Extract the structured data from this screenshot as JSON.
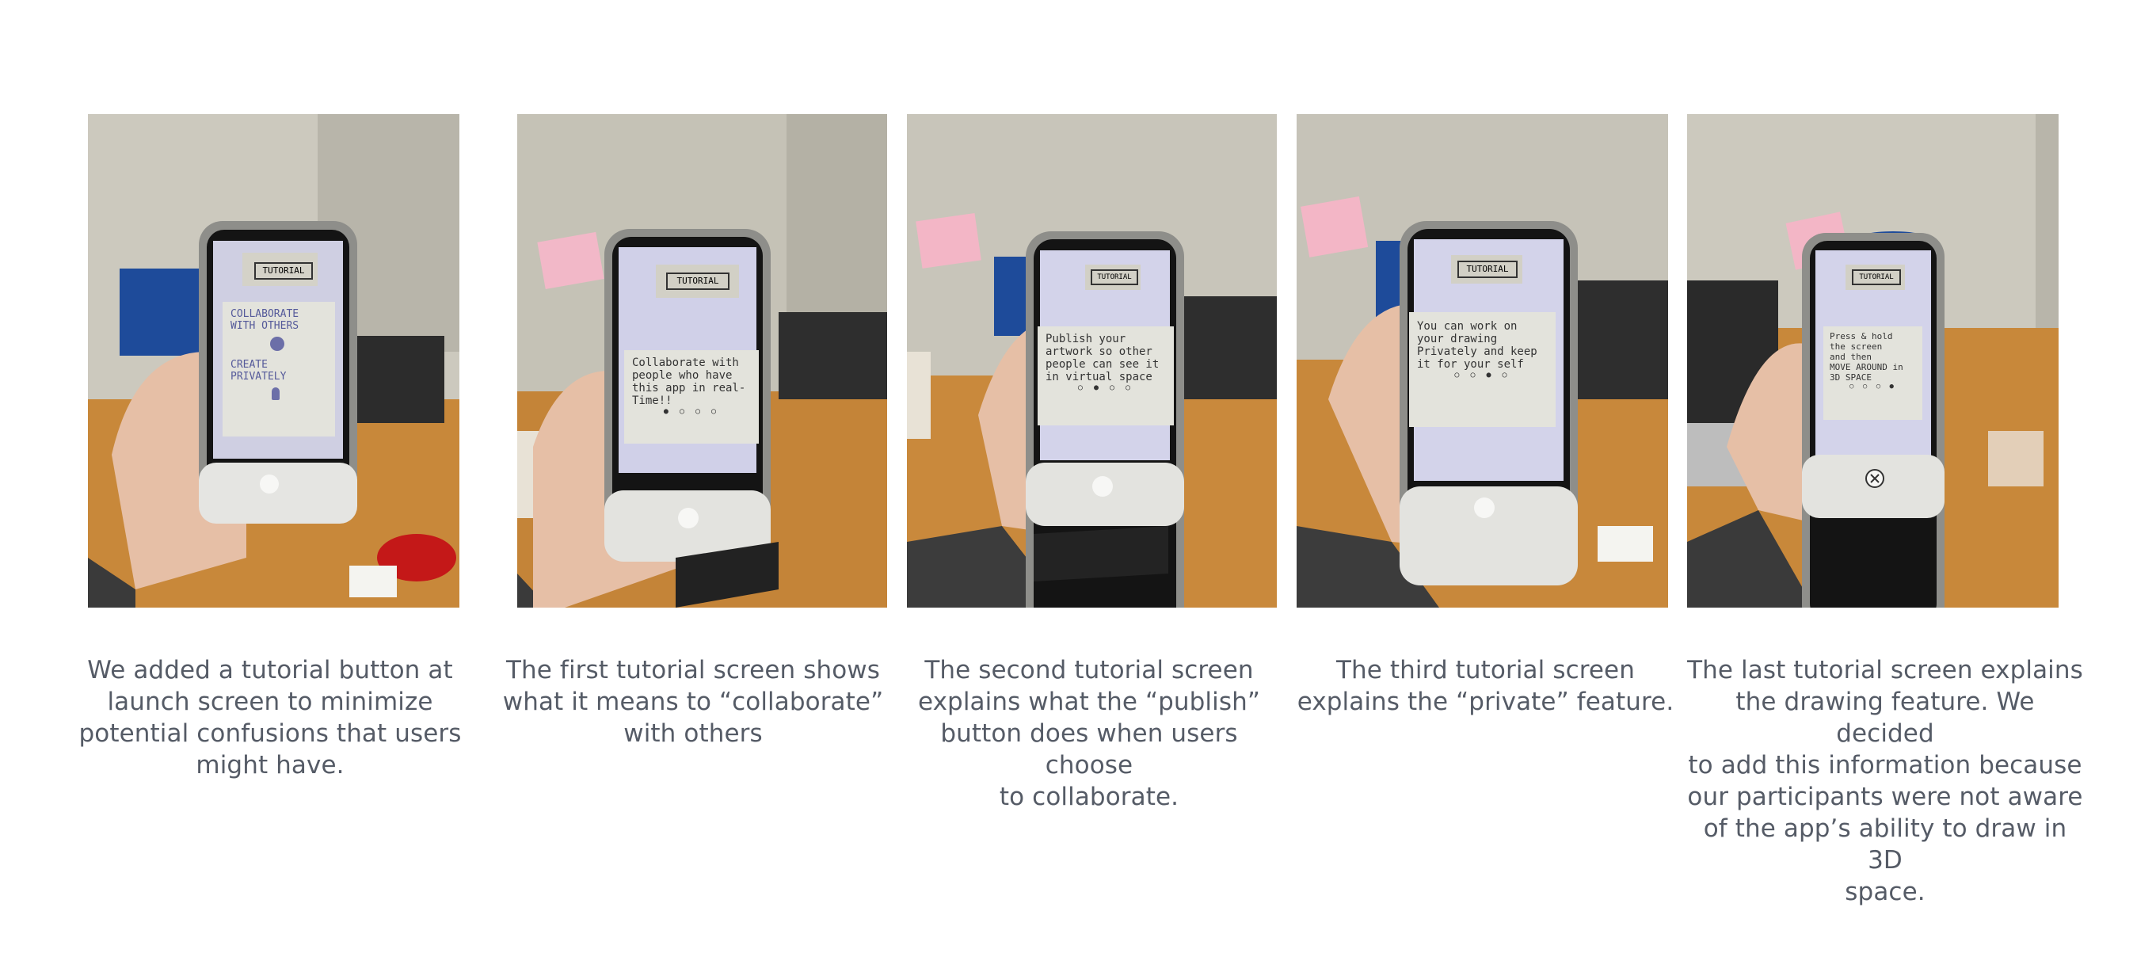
{
  "panels": [
    {
      "screen": {
        "header": "TUTORIAL",
        "lines": [
          "COLLABORATE",
          "WITH OTHERS",
          "CREATE",
          "PRIVATELY"
        ],
        "dots": 0
      },
      "caption": [
        "We added a tutorial button at",
        "launch screen to minimize",
        "potential confusions that users",
        "might have."
      ]
    },
    {
      "screen": {
        "header": "TUTORIAL",
        "lines": [
          "Collaborate with",
          "people who have",
          "this app in real-",
          "Time!!"
        ],
        "dots": 4
      },
      "caption": [
        "The first tutorial screen shows",
        "what it means to “collaborate”",
        "with others"
      ]
    },
    {
      "screen": {
        "header": "TUTORIAL",
        "lines": [
          "Publish your",
          "artwork so other",
          "people can see it",
          "in virtual space"
        ],
        "dots": 4
      },
      "caption": [
        "The second tutorial screen",
        "explains what the “publish”",
        "button does when users choose",
        "to collaborate."
      ]
    },
    {
      "screen": {
        "header": "TUTORIAL",
        "lines": [
          "You can work on",
          "your drawing",
          "Privately and keep",
          "it for your self"
        ],
        "dots": 4
      },
      "caption": [
        "The third tutorial screen",
        "explains the “private” feature."
      ]
    },
    {
      "screen": {
        "header": "TUTORIAL",
        "lines": [
          "Press & hold",
          "the screen",
          "and then",
          "MOVE AROUND in",
          "3D SPACE"
        ],
        "dots": 4
      },
      "caption": [
        "The last tutorial screen explains",
        "the drawing feature. We decided",
        "to add this information because",
        "our participants were not aware",
        "of the app’s ability to draw in 3D",
        "space."
      ]
    }
  ],
  "colors": {
    "caption_text": "#555b66",
    "wall": "#c9c6bb",
    "table": "#c8883a",
    "sleeve": "#3a3a3a",
    "skin": "#e6bfa6",
    "paper": "#e3e3dc"
  }
}
